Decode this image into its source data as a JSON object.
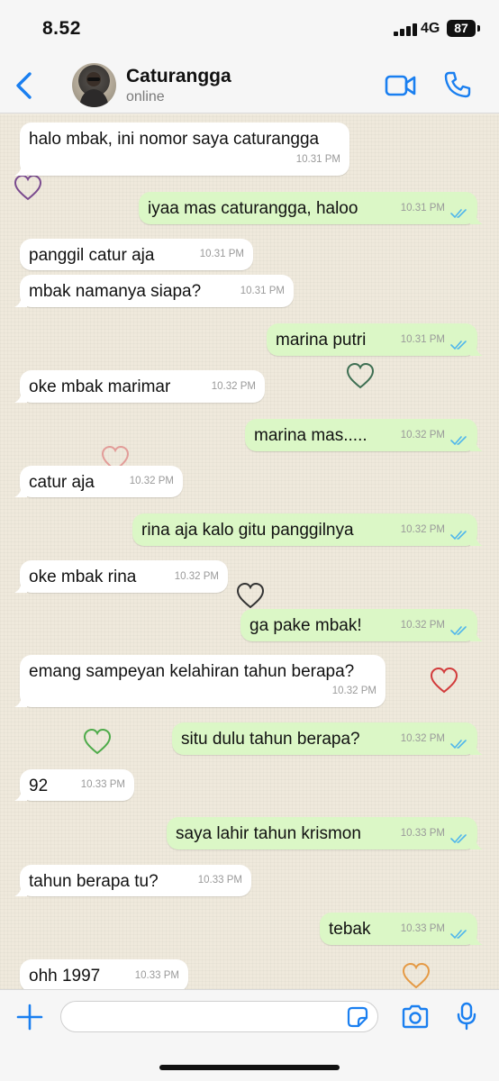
{
  "status_bar": {
    "time": "8.52",
    "network": "4G",
    "battery": "87"
  },
  "header": {
    "contact_name": "Caturangga",
    "contact_status": "online"
  },
  "messages": [
    {
      "dir": "in",
      "text": "halo mbak, ini nomor saya caturangga",
      "time": "10.31 PM"
    },
    {
      "dir": "out",
      "text": "iyaa mas caturangga, haloo",
      "time": "10.31 PM"
    },
    {
      "dir": "in",
      "text": "panggil catur aja",
      "time": "10.31 PM"
    },
    {
      "dir": "in",
      "text": "mbak namanya siapa?",
      "time": "10.31 PM"
    },
    {
      "dir": "out",
      "text": "marina putri",
      "time": "10.31 PM"
    },
    {
      "dir": "in",
      "text": "oke mbak marimar",
      "time": "10.32 PM"
    },
    {
      "dir": "out",
      "text": "marina mas.....",
      "time": "10.32 PM"
    },
    {
      "dir": "in",
      "text": "catur aja",
      "time": "10.32 PM"
    },
    {
      "dir": "out",
      "text": "rina aja kalo gitu panggilnya",
      "time": "10.32 PM"
    },
    {
      "dir": "in",
      "text": "oke mbak rina",
      "time": "10.32 PM"
    },
    {
      "dir": "out",
      "text": "ga pake mbak!",
      "time": "10.32 PM"
    },
    {
      "dir": "in",
      "text": "emang sampeyan kelahiran tahun berapa?",
      "time": "10.32 PM"
    },
    {
      "dir": "out",
      "text": "situ dulu tahun berapa?",
      "time": "10.32 PM"
    },
    {
      "dir": "in",
      "text": "92",
      "time": "10.33 PM"
    },
    {
      "dir": "out",
      "text": "saya lahir tahun krismon",
      "time": "10.33 PM"
    },
    {
      "dir": "in",
      "text": "tahun berapa tu?",
      "time": "10.33 PM"
    },
    {
      "dir": "out",
      "text": "tebak",
      "time": "10.33 PM"
    },
    {
      "dir": "in",
      "text": "ohh 1997",
      "time": "10.33 PM"
    }
  ],
  "input": {
    "value": "",
    "placeholder": ""
  },
  "icons": {
    "back": "chevron-left-icon",
    "video": "video-camera-icon",
    "call": "phone-icon",
    "plus": "plus-icon",
    "sticker": "sticker-icon",
    "camera": "camera-icon",
    "mic": "microphone-icon",
    "read": "double-check-icon"
  },
  "colors": {
    "accent": "#1a7ff0",
    "incoming_bubble": "#ffffff",
    "outgoing_bubble": "#dbf7c6",
    "read_ticks": "#4fb6ec",
    "wallpaper": "#efe9dc"
  }
}
